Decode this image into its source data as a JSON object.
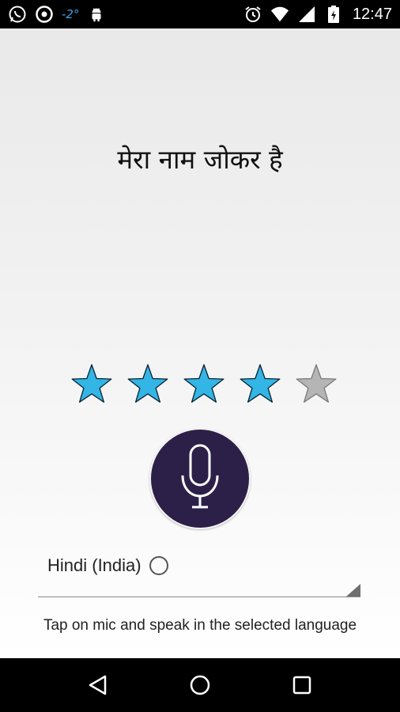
{
  "status_bar": {
    "temperature": "-2°",
    "time": "12:47",
    "icons": [
      "whatsapp-icon",
      "app-circle-icon",
      "android-icon",
      "alarm-icon",
      "wifi-icon",
      "signal-icon",
      "battery-icon"
    ]
  },
  "main": {
    "recognized_text": "मेरा नाम जोकर है",
    "rating": {
      "value": 4,
      "max": 5
    },
    "mic_icon": "microphone-icon",
    "language": {
      "label": "Hindi (India)"
    },
    "hint": "Tap on mic and speak in the selected language"
  },
  "colors": {
    "star_filled": "#33b5e5",
    "star_empty": "#b5b5b5",
    "mic_bg": "#2c2048"
  },
  "nav_bar": {
    "icons": [
      "back-icon",
      "home-icon",
      "recents-icon"
    ]
  }
}
